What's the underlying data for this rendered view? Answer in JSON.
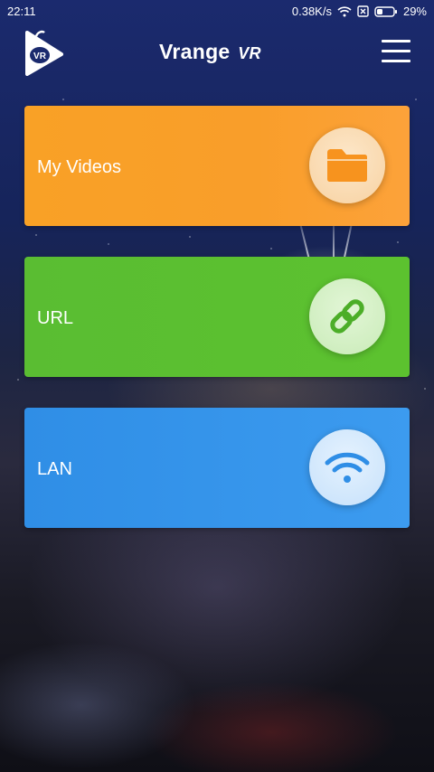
{
  "status_bar": {
    "time": "22:11",
    "network_speed": "0.38K/s",
    "battery": "29%",
    "icons": [
      "wifi-icon",
      "sim-icon",
      "battery-icon"
    ]
  },
  "header": {
    "title": "Vrange",
    "title_suffix": "VR",
    "logo_text": "VR",
    "menu_icon": "hamburger-menu-icon"
  },
  "cards": [
    {
      "label": "My Videos",
      "icon": "folder-icon",
      "color": "#F9A126"
    },
    {
      "label": "URL",
      "icon": "link-icon",
      "color": "#5ABD32"
    },
    {
      "label": "LAN",
      "icon": "wifi-icon",
      "color": "#2F8EE6"
    }
  ],
  "colors": {
    "orange_card": "#F9A126",
    "green_card": "#5ABD32",
    "blue_card": "#2F8EE6",
    "text": "#FFFFFF"
  }
}
